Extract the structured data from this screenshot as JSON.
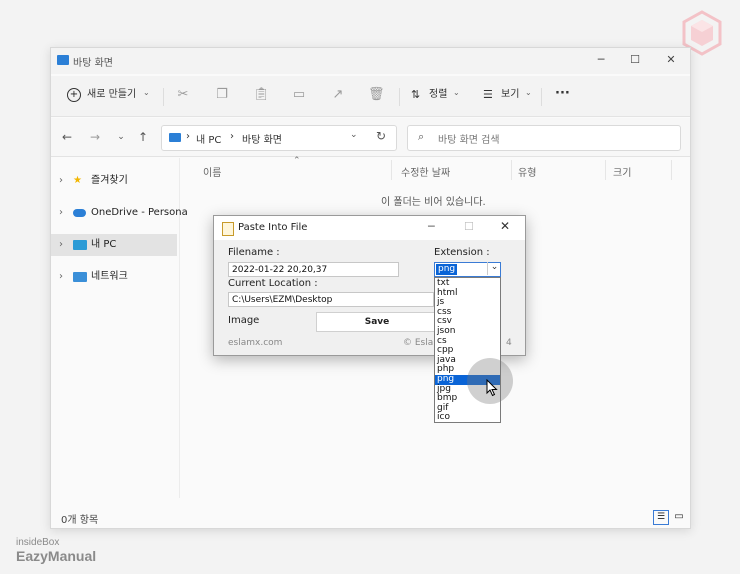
{
  "explorer": {
    "title": "바탕 화면",
    "toolbar": {
      "new_label": "새로 만들기",
      "sort_label": "정렬",
      "view_label": "보기",
      "more_label": "···"
    },
    "address": {
      "path": [
        "내 PC",
        "바탕 화면"
      ],
      "search_placeholder": "바탕 화면 검색"
    },
    "sidebar": [
      {
        "label": "즐겨찾기"
      },
      {
        "label": "OneDrive - Persona"
      },
      {
        "label": "내 PC"
      },
      {
        "label": "네트워크"
      }
    ],
    "columns": [
      "이름",
      "수정한 날짜",
      "유형",
      "크기"
    ],
    "empty_message": "이 폴더는 비어 있습니다.",
    "status": "0개 항목"
  },
  "dialog": {
    "title": "Paste Into File",
    "filename_label": "Filename :",
    "filename_value": "2022-01-22 20,20,37",
    "extension_label": "Extension :",
    "extension_value": "png",
    "location_label": "Current Location :",
    "location_value": "C:\\Users\\EZM\\Desktop",
    "image_label": "Image",
    "save_label": "Save",
    "footer_left": "eslamx.com",
    "footer_right": "© Esla",
    "footer_right_tail": "4",
    "options": [
      "txt",
      "html",
      "js",
      "css",
      "csv",
      "json",
      "cs",
      "cpp",
      "java",
      "php",
      "png",
      "jpg",
      "bmp",
      "gif",
      "ico"
    ],
    "highlighted_option": "png"
  },
  "watermark": {
    "line1": "insideBox",
    "line2": "EazyManual"
  },
  "colors": {
    "accent": "#0a64d6",
    "folder_blue": "#2b7fd6",
    "star": "#f2b600",
    "watermark_pink": "#f2b8be"
  }
}
